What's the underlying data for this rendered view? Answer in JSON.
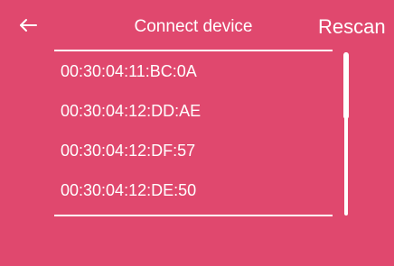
{
  "header": {
    "back_icon": "arrow-left-icon",
    "title": "Connect device",
    "rescan_label": "Rescan"
  },
  "devices": [
    {
      "address": "00:30:04:11:BC:0A"
    },
    {
      "address": "00:30:04:12:DD:AE"
    },
    {
      "address": "00:30:04:12:DF:57"
    },
    {
      "address": "00:30:04:12:DE:50"
    }
  ],
  "colors": {
    "background": "#E0486E",
    "foreground": "#FFFFFF"
  }
}
